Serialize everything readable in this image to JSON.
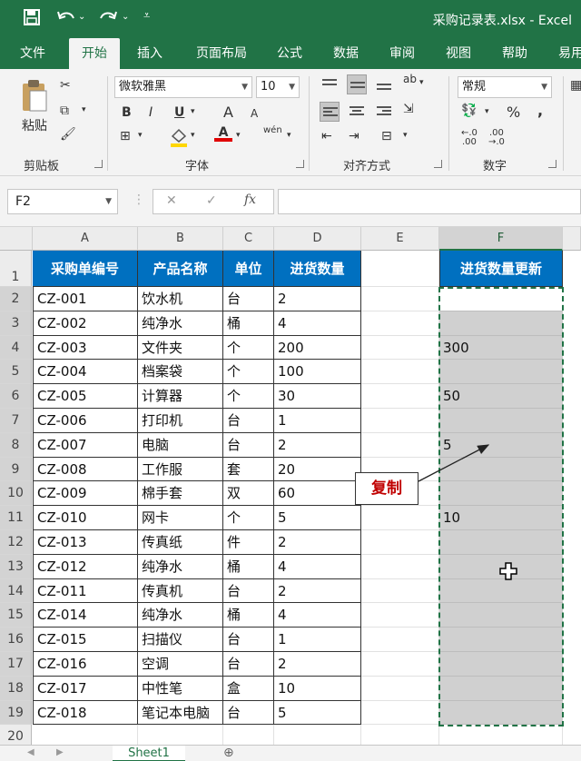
{
  "window": {
    "title": "采购记录表.xlsx  -  Excel"
  },
  "quick_access": {
    "save_icon": "save-icon",
    "undo_icon": "undo-icon",
    "redo_icon": "redo-icon",
    "customize_icon": "customize-icon"
  },
  "tabs": [
    {
      "label": "文件"
    },
    {
      "label": "开始"
    },
    {
      "label": "插入"
    },
    {
      "label": "页面布局"
    },
    {
      "label": "公式"
    },
    {
      "label": "数据"
    },
    {
      "label": "审阅"
    },
    {
      "label": "视图"
    },
    {
      "label": "帮助"
    },
    {
      "label": "易用"
    }
  ],
  "ribbon": {
    "clipboard": {
      "label": "剪贴板",
      "paste": "粘贴"
    },
    "font": {
      "label": "字体",
      "name": "微软雅黑",
      "size": "10",
      "bold": "B",
      "italic": "I",
      "underline": "U",
      "grow": "A",
      "shrink": "A",
      "phonetic": "wén",
      "font_color_letter": "A"
    },
    "alignment": {
      "label": "对齐方式",
      "orientation": "ab"
    },
    "number": {
      "label": "数字",
      "format": "常规",
      "percent": "%",
      "comma": ","
    }
  },
  "formula_bar": {
    "name_box": "F2",
    "fx": "fx",
    "cancel": "✕",
    "enter": "✓",
    "value": ""
  },
  "columns": [
    "A",
    "B",
    "C",
    "D",
    "E",
    "F"
  ],
  "table": {
    "headers": [
      "采购单编号",
      "产品名称",
      "单位",
      "进货数量"
    ],
    "rows": [
      [
        "CZ-001",
        "饮水机",
        "台",
        "2"
      ],
      [
        "CZ-002",
        "纯净水",
        "桶",
        "4"
      ],
      [
        "CZ-003",
        "文件夹",
        "个",
        "200"
      ],
      [
        "CZ-004",
        "档案袋",
        "个",
        "100"
      ],
      [
        "CZ-005",
        "计算器",
        "个",
        "30"
      ],
      [
        "CZ-006",
        "打印机",
        "台",
        "1"
      ],
      [
        "CZ-007",
        "电脑",
        "台",
        "2"
      ],
      [
        "CZ-008",
        "工作服",
        "套",
        "20"
      ],
      [
        "CZ-009",
        "棉手套",
        "双",
        "60"
      ],
      [
        "CZ-010",
        "网卡",
        "个",
        "5"
      ],
      [
        "CZ-013",
        "传真纸",
        "件",
        "2"
      ],
      [
        "CZ-012",
        "纯净水",
        "桶",
        "4"
      ],
      [
        "CZ-011",
        "传真机",
        "台",
        "2"
      ],
      [
        "CZ-014",
        "纯净水",
        "桶",
        "4"
      ],
      [
        "CZ-015",
        "扫描仪",
        "台",
        "1"
      ],
      [
        "CZ-016",
        "空调",
        "台",
        "2"
      ],
      [
        "CZ-017",
        "中性笔",
        "盒",
        "10"
      ],
      [
        "CZ-018",
        "笔记本电脑",
        "台",
        "5"
      ]
    ]
  },
  "column_f": {
    "header": "进货数量更新",
    "values": [
      "",
      "",
      "300",
      "",
      "50",
      "",
      "5",
      "",
      "",
      "10",
      "",
      "",
      "",
      "",
      "",
      "",
      "",
      ""
    ]
  },
  "row_numbers": [
    "1",
    "2",
    "3",
    "4",
    "5",
    "6",
    "7",
    "8",
    "9",
    "10",
    "11",
    "12",
    "13",
    "14",
    "15",
    "16",
    "17",
    "18",
    "19",
    "20"
  ],
  "annotation": {
    "callout": "复制"
  },
  "sheets": {
    "active": "Sheet1"
  },
  "colors": {
    "excel_green": "#217346",
    "header_blue": "#0070c0",
    "callout_red": "#c00000",
    "filled_gray": "#d0d0d0"
  }
}
